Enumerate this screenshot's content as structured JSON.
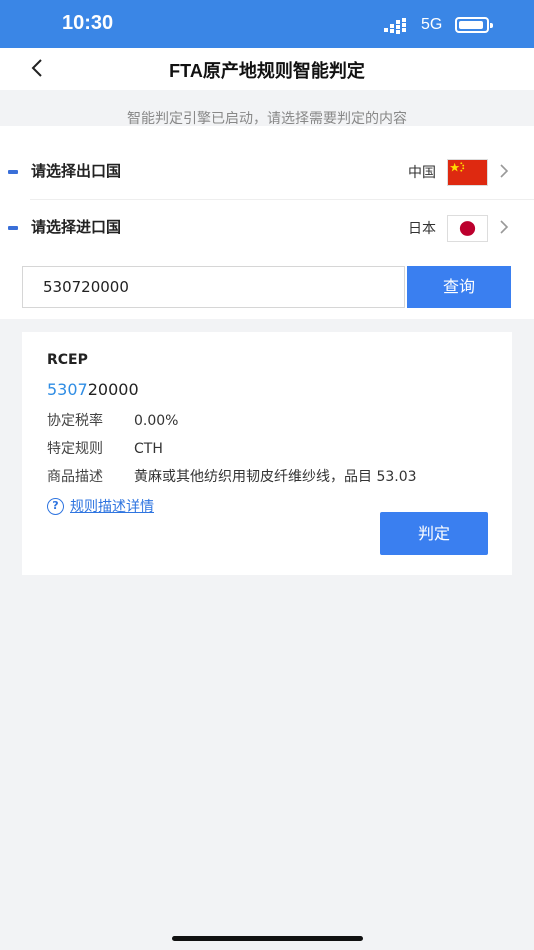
{
  "status_bar": {
    "time": "10:30",
    "network": "5G"
  },
  "header": {
    "title": "FTA原产地规则智能判定"
  },
  "hint": "智能判定引擎已启动，请选择需要判定的内容",
  "export_country": {
    "label": "请选择出口国",
    "value": "中国",
    "flag_icon": "china-flag-icon"
  },
  "import_country": {
    "label": "请选择进口国",
    "value": "日本",
    "flag_icon": "japan-flag-icon"
  },
  "search": {
    "value": "530720000",
    "button_label": "查询"
  },
  "result": {
    "agreement": "RCEP",
    "code_highlight": "5307",
    "code_rest": "20000",
    "rows": [
      {
        "key": "协定税率",
        "value": "0.00%"
      },
      {
        "key": "特定规则",
        "value": "CTH"
      },
      {
        "key": "商品描述",
        "value": "黄麻或其他纺织用韧皮纤维纱线，品目 53.03"
      }
    ],
    "detail_link": "规则描述详情",
    "judge_button": "判定"
  },
  "colors": {
    "accent": "#3a7ff0",
    "status_bar": "#3a86e6",
    "link": "#2f75e0"
  }
}
